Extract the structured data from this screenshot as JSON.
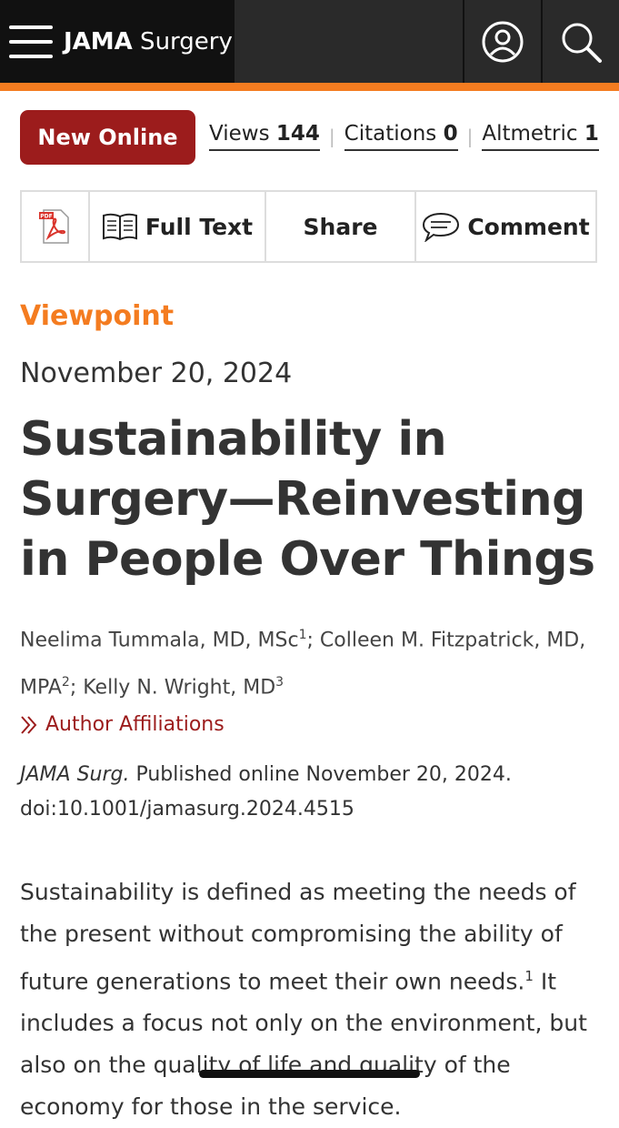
{
  "header": {
    "brand_bold": "JAMA",
    "brand_rest": " Surgery"
  },
  "metrics": {
    "badge": "New Online",
    "views_label": "Views",
    "views_value": "144",
    "citations_label": "Citations",
    "citations_value": "0",
    "altmetric_label": "Altmetric",
    "altmetric_value": "1"
  },
  "toolbar": {
    "pdf_icon_text": "PDF",
    "full_text": "Full Text",
    "share": "Share",
    "comment": "Comment"
  },
  "article": {
    "category": "Viewpoint",
    "date": "November 20, 2024",
    "title": "Sustainability in Surgery—Reinvesting in People Over Things",
    "authors": [
      {
        "name": "Neelima Tummala, MD, MSc",
        "sup": "1",
        "sep": "; "
      },
      {
        "name": "Colleen M. Fitzpatrick, MD, MPA",
        "sup": "2",
        "sep": "; "
      },
      {
        "name": "Kelly N. Wright, MD",
        "sup": "3",
        "sep": ""
      }
    ],
    "affiliations_link": "Author Affiliations",
    "journal_abbrev": "JAMA Surg.",
    "published": " Published online November 20, 2024.",
    "doi": "doi:10.1001/jamasurg.2024.4515",
    "body_part1": "Sustainability is defined as meeting the needs of the present without compromising the ability of future generations to meet their own needs.",
    "body_ref": "1",
    "body_part2": " It includes a focus not only on the environment, but also on the quality of life and quality of the economy for those in the service."
  },
  "colors": {
    "accent": "#f47c20",
    "brand_red": "#9c1c1c",
    "header_dark": "#111111"
  },
  "icons": [
    "menu-icon",
    "user-icon",
    "search-icon",
    "pdf-icon",
    "book-icon",
    "comment-icon",
    "chevron-right-icon"
  ]
}
